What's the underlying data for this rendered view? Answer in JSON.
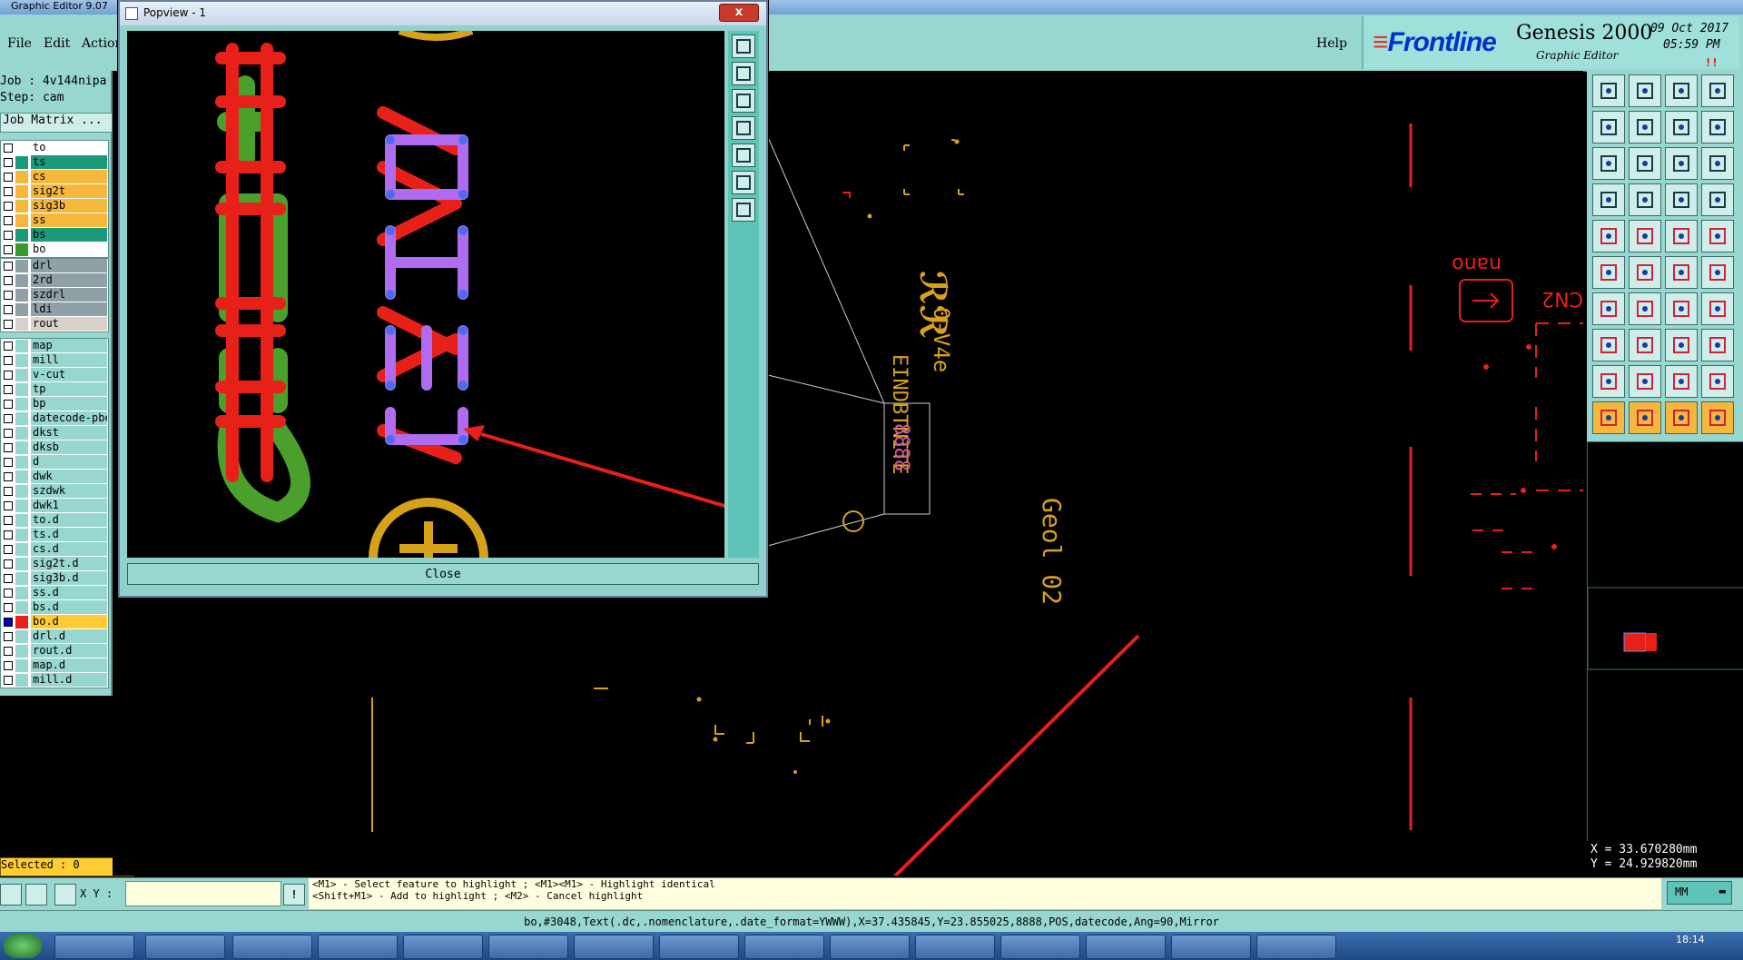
{
  "app": {
    "window_title": "Graphic Editor 9.07",
    "help_label": "Help"
  },
  "menu": [
    "File",
    "Edit",
    "Action"
  ],
  "brand": {
    "logo": "Frontline",
    "product": "Genesis 2000",
    "subtitle": "Graphic Editor",
    "date": "09 Oct 2017",
    "time": "05:59 PM",
    "marker": "!!"
  },
  "job": {
    "job_line": "Job : 4v144nipa",
    "step_line": "Step: cam",
    "matrix_label": "Job Matrix ..."
  },
  "layer_groups": [
    [
      {
        "name": "to",
        "color": "#ffffff",
        "bg": "#ffffff"
      },
      {
        "name": "ts",
        "color": "#1a9a7a",
        "bg": "#1a9a7a"
      },
      {
        "name": "cs",
        "color": "#f5b73c",
        "bg": "#f5b73c"
      },
      {
        "name": "sig2t",
        "color": "#f5b73c",
        "bg": "#f5b73c"
      },
      {
        "name": "sig3b",
        "color": "#f5b73c",
        "bg": "#f5b73c"
      },
      {
        "name": "ss",
        "color": "#f5b73c",
        "bg": "#f5b73c"
      },
      {
        "name": "bs",
        "color": "#1a9a7a",
        "bg": "#1a9a7a"
      },
      {
        "name": "bo",
        "color": "#3a9a2a",
        "bg": "#ffffff"
      }
    ],
    [
      {
        "name": "drl",
        "color": "#8fa0a6",
        "bg": "#8fa0a6"
      },
      {
        "name": "2rd",
        "color": "#8fa0a6",
        "bg": "#8fa0a6"
      },
      {
        "name": "szdrl",
        "color": "#8fa0a6",
        "bg": "#8fa0a6"
      },
      {
        "name": "ldi",
        "color": "#8fa0a6",
        "bg": "#8fa0a6"
      },
      {
        "name": "rout",
        "color": "#d9d0c9",
        "bg": "#d9d0c9"
      }
    ],
    [
      {
        "name": "map",
        "color": "#98d6d0",
        "bg": "#98d6d0"
      },
      {
        "name": "mill",
        "color": "#98d6d0",
        "bg": "#98d6d0"
      },
      {
        "name": "v-cut",
        "color": "#98d6d0",
        "bg": "#98d6d0"
      },
      {
        "name": "tp",
        "color": "#98d6d0",
        "bg": "#98d6d0"
      },
      {
        "name": "bp",
        "color": "#98d6d0",
        "bg": "#98d6d0"
      },
      {
        "name": "datecode-pbe",
        "color": "#98d6d0",
        "bg": "#98d6d0"
      },
      {
        "name": "dkst",
        "color": "#98d6d0",
        "bg": "#98d6d0"
      },
      {
        "name": "dksb",
        "color": "#98d6d0",
        "bg": "#98d6d0"
      },
      {
        "name": "d",
        "color": "#98d6d0",
        "bg": "#98d6d0"
      },
      {
        "name": "dwk",
        "color": "#98d6d0",
        "bg": "#98d6d0"
      },
      {
        "name": "szdwk",
        "color": "#98d6d0",
        "bg": "#98d6d0"
      },
      {
        "name": "dwk1",
        "color": "#98d6d0",
        "bg": "#98d6d0"
      },
      {
        "name": "to.d",
        "color": "#98d6d0",
        "bg": "#98d6d0"
      },
      {
        "name": "ts.d",
        "color": "#98d6d0",
        "bg": "#98d6d0"
      },
      {
        "name": "cs.d",
        "color": "#98d6d0",
        "bg": "#98d6d0"
      },
      {
        "name": "sig2t.d",
        "color": "#98d6d0",
        "bg": "#98d6d0"
      },
      {
        "name": "sig3b.d",
        "color": "#98d6d0",
        "bg": "#98d6d0"
      },
      {
        "name": "ss.d",
        "color": "#98d6d0",
        "bg": "#98d6d0"
      },
      {
        "name": "bs.d",
        "color": "#98d6d0",
        "bg": "#98d6d0"
      },
      {
        "name": "bo.d",
        "color": "#e8201a",
        "bg": "#ffcc33",
        "checked": true
      },
      {
        "name": "drl.d",
        "color": "#98d6d0",
        "bg": "#98d6d0"
      },
      {
        "name": "rout.d",
        "color": "#98d6d0",
        "bg": "#98d6d0"
      },
      {
        "name": "map.d",
        "color": "#98d6d0",
        "bg": "#98d6d0"
      },
      {
        "name": "mill.d",
        "color": "#98d6d0",
        "bg": "#98d6d0"
      }
    ]
  ],
  "selected_label": "Selected : 0",
  "xy_label": "X Y :",
  "xy_value": "",
  "messages": {
    "line1": "<M1> - Select feature to highlight ; <M1><M1> - Highlight identical",
    "line2": "<Shift+M1> - Add to highlight ; <M2> - Cancel highlight"
  },
  "units": "MM",
  "coords": {
    "x": "X = 33.670280mm",
    "y": "Y = 24.929820mm"
  },
  "status_line": "bo,#3048,Text(.dc,.nomenclature,.date_format=YWWW),X=37.435845,Y=23.855025,8888,POS,datecode,Ang=90,Mirror",
  "popview": {
    "title": "Popview - 1",
    "close_label": "Close",
    "close_x": "x"
  },
  "canvas_text": {
    "geol": "Geol 02",
    "nano": "nano",
    "cn2": "CN2",
    "v4e": "0-V4e",
    "digits": "8888"
  },
  "clock": "18:14",
  "colors": {
    "panel": "#98d6d0",
    "accent_red": "#e8201a",
    "accent_orange": "#f5b73c",
    "silk_yellow": "#d6a21a"
  }
}
